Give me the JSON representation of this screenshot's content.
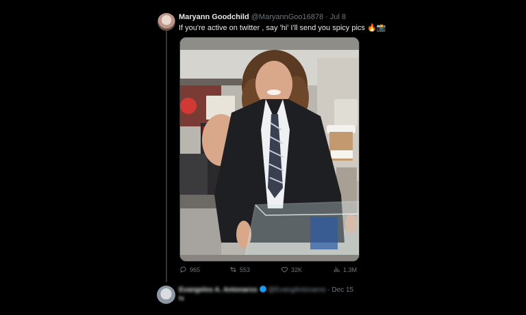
{
  "tweet": {
    "author_name": "Maryann Goodchild",
    "handle": "@MaryannGoo16878",
    "separator": "·",
    "date": "Jul 8",
    "text": "If you're active on twitter , say 'hi' I'll send you spicy pics 🔥📸"
  },
  "actions": {
    "replies": "965",
    "retweets": "553",
    "likes": "32K",
    "views": "1.3M"
  },
  "reply": {
    "author_name": "Evangelos A. Antonaros",
    "handle": "@EvangAntonaros",
    "date": "· Dec 15",
    "snippet": "hi"
  },
  "colors": {
    "background": "#000000",
    "text_primary": "#e7e9ea",
    "text_secondary": "#71767b",
    "verified": "#1d9bf0"
  }
}
